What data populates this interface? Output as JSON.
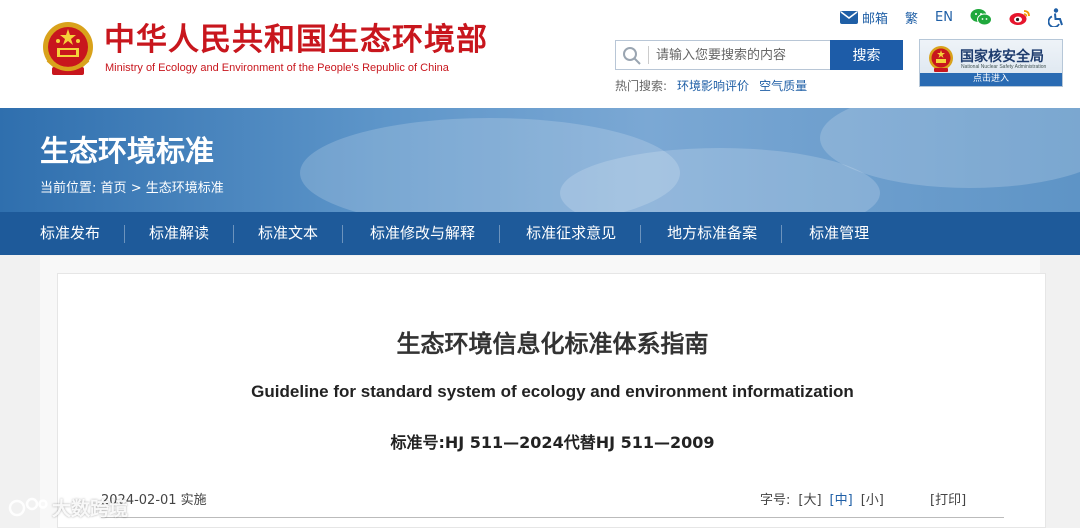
{
  "header": {
    "title": "中华人民共和国生态环境部",
    "subtitle": "Ministry of Ecology and Environment of the People's Republic of China",
    "top_links": {
      "mail": "邮箱",
      "traditional": "繁",
      "english": "EN"
    },
    "search": {
      "placeholder": "请输入您要搜索的内容",
      "button": "搜索"
    },
    "hot_search": {
      "label": "热门搜索:",
      "items": [
        "环境影响评价",
        "空气质量"
      ]
    },
    "nnsa": {
      "name": "国家核安全局",
      "english": "National Nuclear Safety Administration",
      "enter": "点击进入"
    }
  },
  "banner": {
    "title": "生态环境标准",
    "breadcrumb": {
      "prefix": "当前位置:",
      "home": "首页",
      "sep": ">",
      "current": "生态环境标准"
    }
  },
  "nav": {
    "items": [
      "标准发布",
      "标准解读",
      "标准文本",
      "标准修改与解释",
      "标准征求意见",
      "地方标准备案",
      "标准管理"
    ]
  },
  "document": {
    "title": "生态环境信息化标准体系指南",
    "english_title": "Guideline for standard system of ecology and environment informatization",
    "standard_no": "标准号:HJ 511—2024代替HJ 511—2009",
    "date": "2024-02-01 实施",
    "font_size_label": "字号:",
    "font_sizes": [
      "[大]",
      "[中]",
      "[小]"
    ],
    "print": "[打印]"
  },
  "watermark": {
    "text": "大数跨境"
  },
  "colors": {
    "brand_red": "#c8161d",
    "nav_blue": "#1e5a9a",
    "link_blue": "#1f5fa6"
  }
}
